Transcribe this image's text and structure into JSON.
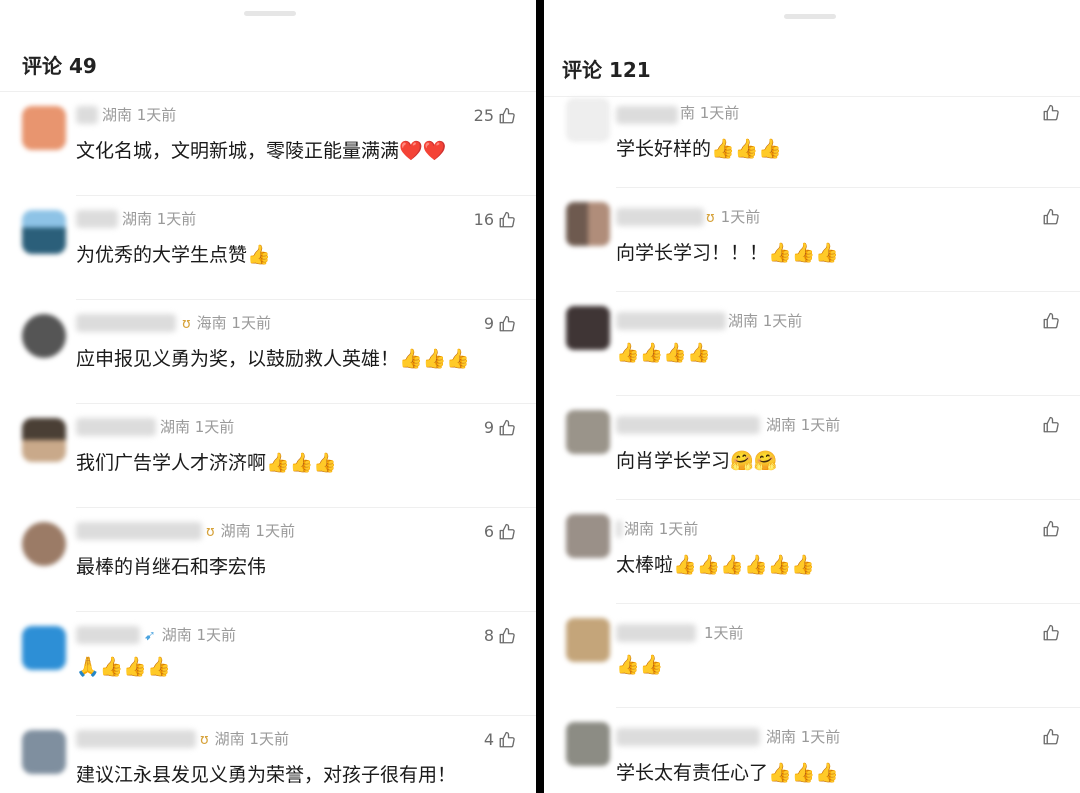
{
  "left": {
    "header": "评论 49",
    "comments": [
      {
        "location": "湖南 1天前",
        "likes": "25",
        "text": "文化名城，文明新城，零陵正能量满满",
        "emoji": "❤️❤️",
        "avatar": "#e8956f",
        "badge": ""
      },
      {
        "location": "湖南 1天前",
        "likes": "16",
        "text": "为优秀的大学生点赞",
        "emoji": "👍",
        "avatar": "#3b7aa3",
        "badge": ""
      },
      {
        "location": "海南 1天前",
        "likes": "9",
        "text": "应申报见义勇为奖，以鼓励救人英雄！",
        "emoji": "👍👍👍",
        "avatar": "#555555",
        "badge": "ʊ"
      },
      {
        "location": "湖南 1天前",
        "likes": "9",
        "text": "我们广告学人才济济啊",
        "emoji": "👍👍👍",
        "avatar": "#6b5a4a",
        "badge": ""
      },
      {
        "location": "湖南 1天前",
        "likes": "6",
        "text": "最棒的肖继石和李宏伟",
        "emoji": "",
        "avatar": "#9b7b66",
        "badge": "ʊ"
      },
      {
        "location": "湖南 1天前",
        "likes": "8",
        "text": "",
        "emoji": "🙏👍👍👍",
        "avatar": "#2d8fd6",
        "badge": "➹"
      },
      {
        "location": "湖南 1天前",
        "likes": "4",
        "text": "建议江永县发见义勇为荣誉，对孩子很有用！",
        "emoji": "",
        "avatar": "#7f8f9f",
        "badge": "ʊ"
      }
    ]
  },
  "right": {
    "header": "评论 121",
    "comments": [
      {
        "location": "南 1天前",
        "text": "学长好样的",
        "emoji": "👍👍👍",
        "avatar": "#eeeeee",
        "badge": ""
      },
      {
        "location": "1天前",
        "text": "向学长学习！！！",
        "emoji": "👍👍👍",
        "avatar": "#8a6f62",
        "badge": "ʊ"
      },
      {
        "location": "湖南 1天前",
        "text": "",
        "emoji": "👍👍👍👍",
        "avatar": "#3f3535",
        "badge": ""
      },
      {
        "location": "湖南 1天前",
        "text": "向肖学长学习",
        "emoji": "🤗🤗",
        "avatar": "#9a948a",
        "badge": ""
      },
      {
        "location": "湖南 1天前",
        "text": "太棒啦",
        "emoji": "👍👍👍👍👍👍",
        "avatar": "#9a9088",
        "badge": ""
      },
      {
        "location": "1天前",
        "text": "",
        "emoji": "👍👍",
        "avatar": "#c4a57a",
        "badge": ""
      },
      {
        "location": "湖南 1天前",
        "text": "学长太有责任心了",
        "emoji": "👍👍👍",
        "avatar": "#8c8c84",
        "badge": ""
      }
    ]
  }
}
